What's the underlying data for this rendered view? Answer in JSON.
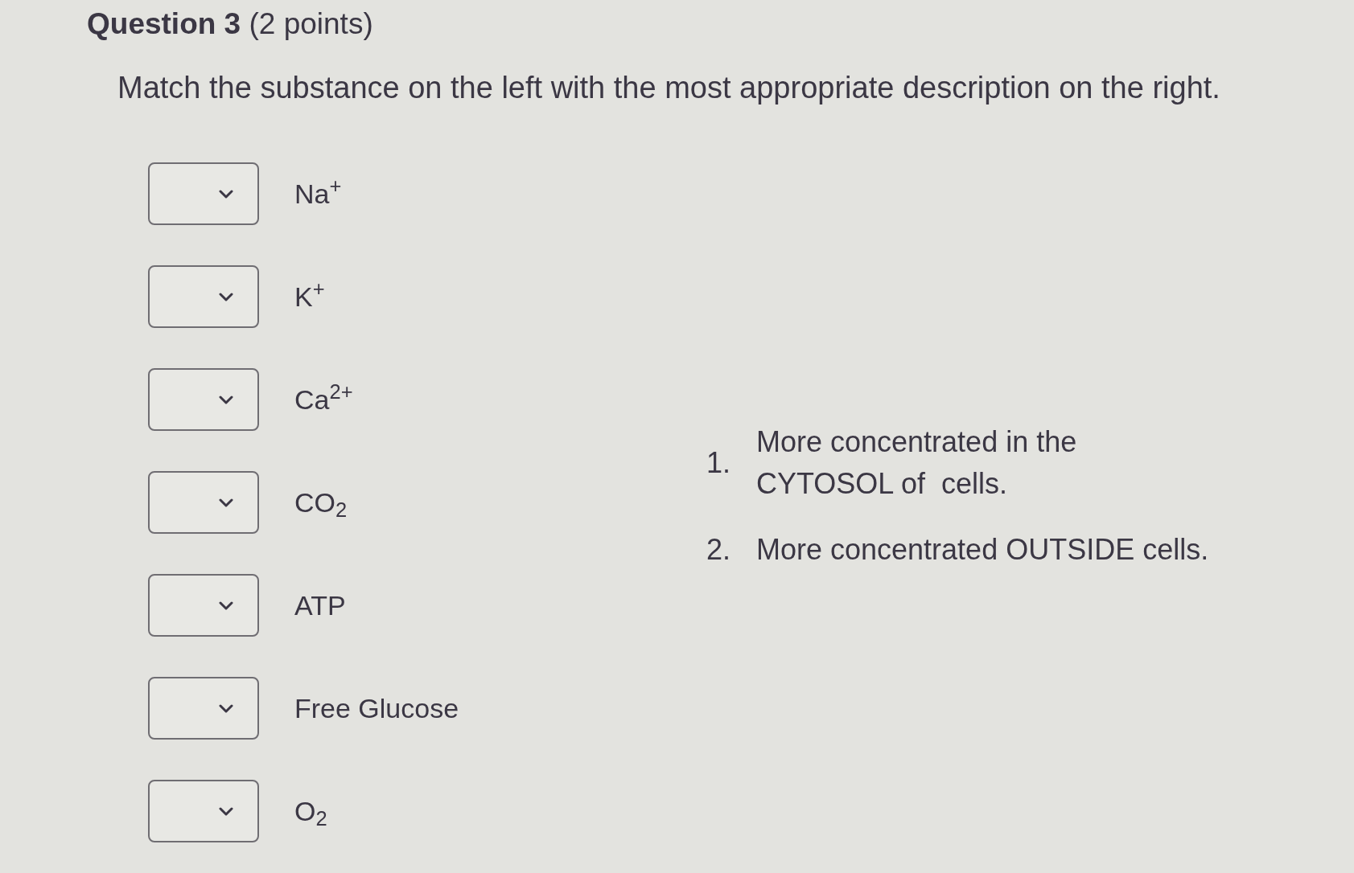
{
  "question": {
    "title": "**Question 3** (2 points)",
    "prompt": "Match the substance on the left with the most appropriate description on the right."
  },
  "matches": [
    {
      "substance": "Na$^{+}$"
    },
    {
      "substance": "K$^{+}$"
    },
    {
      "substance": "Ca$^{2+}$"
    },
    {
      "substance": "CO$_{2}$"
    },
    {
      "substance": "ATP"
    },
    {
      "substance": "Free Glucose"
    },
    {
      "substance": "O$_{2}$"
    }
  ],
  "descriptions": [
    {
      "number": "1.",
      "text": "More concentrated in the\nCYTOSOL of  cells."
    },
    {
      "number": "2.",
      "text": "More concentrated OUTSIDE cells."
    }
  ]
}
